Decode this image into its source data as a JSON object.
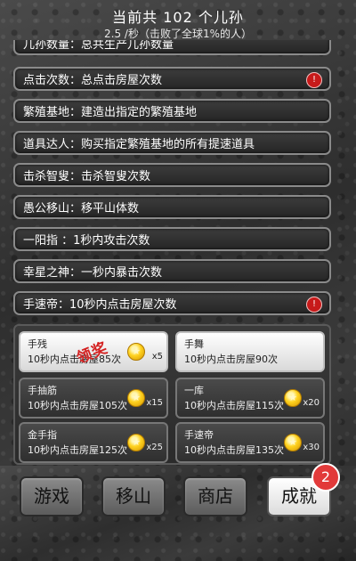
{
  "header": {
    "title": "当前共 102 个儿孙",
    "subtitle": "2.5 /秒（击败了全球1%的人）"
  },
  "achievements": [
    {
      "label": "儿孙数量：总共生产儿孙数量",
      "badge": ""
    },
    {
      "label": "点击次数：总点击房屋次数",
      "badge": "!"
    },
    {
      "label": "繁殖基地：建造出指定的繁殖基地",
      "badge": ""
    },
    {
      "label": "道具达人：购买指定繁殖基地的所有提速道具",
      "badge": ""
    },
    {
      "label": "击杀智叟：击杀智叟次数",
      "badge": ""
    },
    {
      "label": "愚公移山：移平山体数",
      "badge": ""
    },
    {
      "label": "一阳指  ：1秒内攻击次数",
      "badge": ""
    },
    {
      "label": "幸星之神：一秒内暴击次数",
      "badge": ""
    },
    {
      "label": "手速帝：10秒内点击房屋次数",
      "badge": "!"
    }
  ],
  "rewards": [
    {
      "name": "手残",
      "desc": "10秒内点击房屋85次",
      "multiplier": "x5",
      "state": "claim",
      "stamp": "领奖"
    },
    {
      "name": "手舞",
      "desc": "10秒内点击房屋90次",
      "multiplier": "",
      "state": "claim",
      "stamp": ""
    },
    {
      "name": "手抽筋",
      "desc": "10秒内点击房屋105次",
      "multiplier": "x15",
      "state": "locked",
      "stamp": ""
    },
    {
      "name": "一库",
      "desc": "10秒内点击房屋115次",
      "multiplier": "x20",
      "state": "locked",
      "stamp": ""
    },
    {
      "name": "金手指",
      "desc": "10秒内点击房屋125次",
      "multiplier": "x25",
      "state": "locked",
      "stamp": ""
    },
    {
      "name": "手速帝",
      "desc": "10秒内点击房屋135次",
      "multiplier": "x30",
      "state": "locked",
      "stamp": ""
    }
  ],
  "nav": {
    "game": "游戏",
    "move_mountain": "移山",
    "shop": "商店",
    "achievements": "成就",
    "achievements_badge": "2"
  },
  "colors": {
    "badge_red": "#c71a1a",
    "stamp_red": "#d42222",
    "coin_gold": "#ffd21f"
  }
}
